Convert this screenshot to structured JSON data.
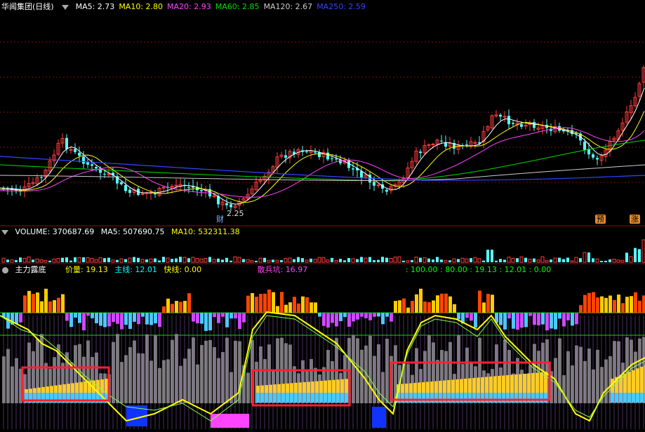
{
  "main": {
    "title": "华闻集团(日线)",
    "indicators": [
      {
        "label": "MA5: 2.73",
        "color": "#ffffff"
      },
      {
        "label": "MA10: 2.80",
        "color": "#ffff00"
      },
      {
        "label": "MA20: 2.93",
        "color": "#ff44ff"
      },
      {
        "label": "MA60: 2.85",
        "color": "#00dd00"
      },
      {
        "label": "MA120: 2.67",
        "color": "#cccccc"
      },
      {
        "label": "MA250: 2.59",
        "color": "#3344ff"
      }
    ],
    "low_annotation": "2.25",
    "tag_cai": "财",
    "tag_yu": "预",
    "tag_zhang": "涨"
  },
  "volume": {
    "label": "VOLUME: 370687.69",
    "ma5": "MA5: 507690.75",
    "ma10": "MA10: 532311.38"
  },
  "indicator": {
    "title": "主力露底",
    "jialiang": "价量: 19.13",
    "zhuxian": "主线: 12.01",
    "kuaixian": "快线: 0.00",
    "sanbing": "散兵坑: 16.97",
    "tail": ": 100.00 : 80.00 : 19.13 : 12.01 : 0.00",
    "colors": {
      "jialiang": "#ffff00",
      "zhuxian": "#00ffff",
      "kuaixian": "#ffff00",
      "sanbing": "#ff44ff",
      "tail": "#00ff00"
    }
  },
  "chart_data": [
    {
      "type": "candlestick",
      "title": "华闻集团(日线)",
      "annotation_low": 2.25,
      "ma": {
        "MA5": 2.73,
        "MA10": 2.8,
        "MA20": 2.93,
        "MA60": 2.85,
        "MA120": 2.67,
        "MA250": 2.59
      }
    },
    {
      "type": "bar",
      "title": "VOLUME",
      "values_latest": {
        "VOLUME": 370687.69,
        "MA5": 507690.75,
        "MA10": 532311.38
      }
    },
    {
      "type": "bar",
      "title": "主力露底",
      "values_latest": {
        "价量": 19.13,
        "主线": 12.01,
        "快线": 0.0,
        "散兵坑": 16.97
      },
      "reference_levels": [
        100.0,
        80.0
      ]
    }
  ]
}
